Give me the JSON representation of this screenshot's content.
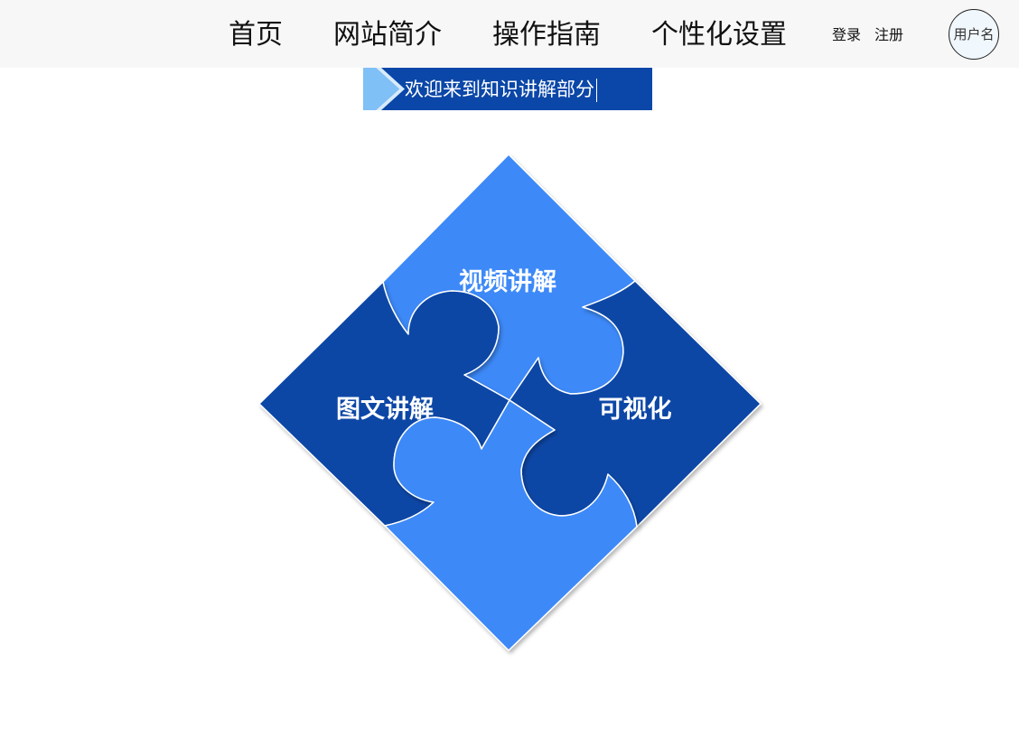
{
  "nav": {
    "items": [
      "首页",
      "网站简介",
      "操作指南",
      "个性化设置"
    ],
    "login": "登录",
    "register": "注册",
    "user": "用户名"
  },
  "banner": {
    "text": "欢迎来到知识讲解部分"
  },
  "puzzle": {
    "pieces": [
      {
        "label": "视频讲解",
        "color": "#3d89f8"
      },
      {
        "label": "可视化",
        "color": "#0a46a6"
      },
      {
        "label": "图文讲解",
        "color": "#0a46a6"
      },
      {
        "label": "",
        "color": "#3d89f8"
      }
    ]
  },
  "colors": {
    "topbar": "#f7f7f7",
    "banner": "#0b47a8",
    "banner_accent": "#7fc0f7",
    "light_blue": "#3d89f8",
    "dark_blue": "#0a46a6"
  }
}
